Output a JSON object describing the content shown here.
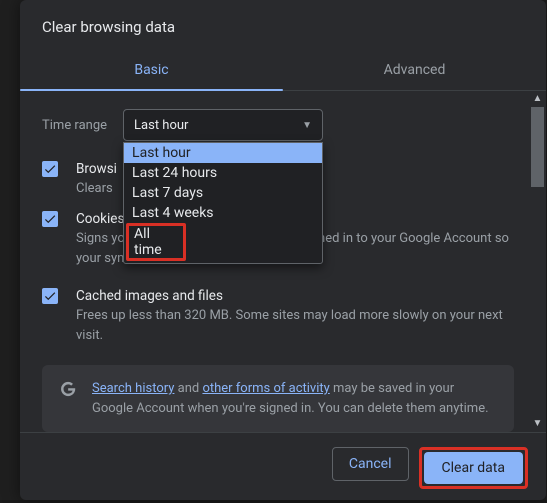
{
  "dialog": {
    "title": "Clear browsing data",
    "tabs": {
      "basic": "Basic",
      "advanced": "Advanced"
    },
    "time_range_label": "Time range",
    "dropdown": {
      "selected": "Last hour",
      "options": [
        "Last hour",
        "Last 24 hours",
        "Last 7 days",
        "Last 4 weeks",
        "All time"
      ]
    },
    "items": [
      {
        "title": "Browsing history",
        "title_truncated": "Browsi",
        "desc_truncated": "Clears"
      },
      {
        "title": "Cookies and other site data",
        "desc": "Signs you out of most sites. You'll stay signed in to your Google Account so your synced data can be cleared."
      },
      {
        "title": "Cached images and files",
        "desc": "Frees up less than 320 MB. Some sites may load more slowly on your next visit."
      }
    ],
    "info": {
      "link1": "Search history",
      "sep": " and ",
      "link2": "other forms of activity",
      "rest": " may be saved in your Google Account when you're signed in. You can delete them anytime."
    },
    "buttons": {
      "cancel": "Cancel",
      "confirm": "Clear data"
    }
  }
}
